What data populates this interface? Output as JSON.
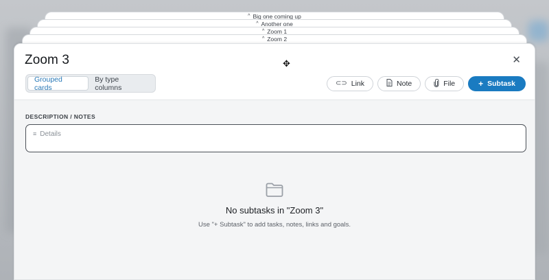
{
  "stack": [
    {
      "label": "Big one coming up",
      "icon": "chevron-up-icon"
    },
    {
      "label": "Another one",
      "icon": "chevron-up-icon"
    },
    {
      "label": "Zoom 1",
      "icon": "chevron-up-icon"
    },
    {
      "label": "Zoom 2",
      "icon": "chevron-up-icon"
    }
  ],
  "modal": {
    "title": "Zoom 3",
    "close_icon": "close-icon",
    "move_icon": "move-icon",
    "view_toggle": {
      "options": [
        "Grouped cards",
        "By type columns"
      ],
      "selected": "Grouped cards"
    },
    "actions": [
      {
        "label": "Link",
        "icon": "link-icon"
      },
      {
        "label": "Note",
        "icon": "note-icon"
      },
      {
        "label": "File",
        "icon": "paperclip-icon"
      },
      {
        "label": "Subtask",
        "icon": "plus-icon"
      }
    ],
    "description": {
      "label": "DESCRIPTION / NOTES",
      "placeholder": "Details"
    },
    "empty_state": {
      "icon": "folder-icon",
      "title": "No subtasks in \"Zoom 3\"",
      "subtitle": "Use \"+ Subtask\" to add tasks, notes, links and goals."
    }
  },
  "colors": {
    "accent": "#1a7bc1",
    "segment_active_text": "#2a7ab8"
  }
}
